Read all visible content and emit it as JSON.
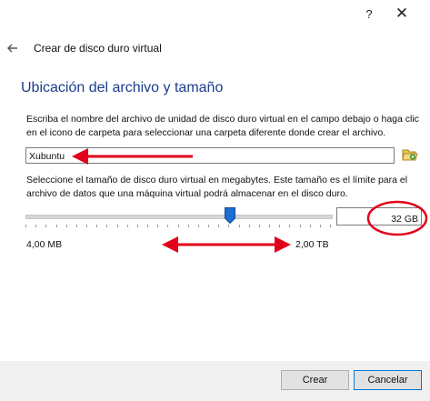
{
  "window": {
    "help_label": "?",
    "close_label": "✕"
  },
  "header": {
    "back_icon": "back-arrow-icon",
    "title": "Crear de disco duro virtual"
  },
  "section": {
    "title": "Ubicación del archivo y tamaño"
  },
  "file": {
    "description": "Escriba el nombre del archivo de unidad de disco duro virtual en el campo debajo o haga clic en el icono de carpeta para seleccionar una carpeta diferente donde crear el archivo.",
    "value": "Xubuntu",
    "folder_icon": "folder-icon"
  },
  "size": {
    "description": "Seleccione el tamaño de disco duro virtual en megabytes. Este tamaño es el límite para el archivo de datos que una máquina virtual podrá almacenar en el disco duro.",
    "value": "32 GB",
    "slider_fraction": 0.67,
    "min_label": "4,00 MB",
    "max_label": "2,00 TB"
  },
  "annotations": {
    "color": "#e3001b"
  },
  "footer": {
    "create_label": "Crear",
    "cancel_label": "Cancelar"
  }
}
